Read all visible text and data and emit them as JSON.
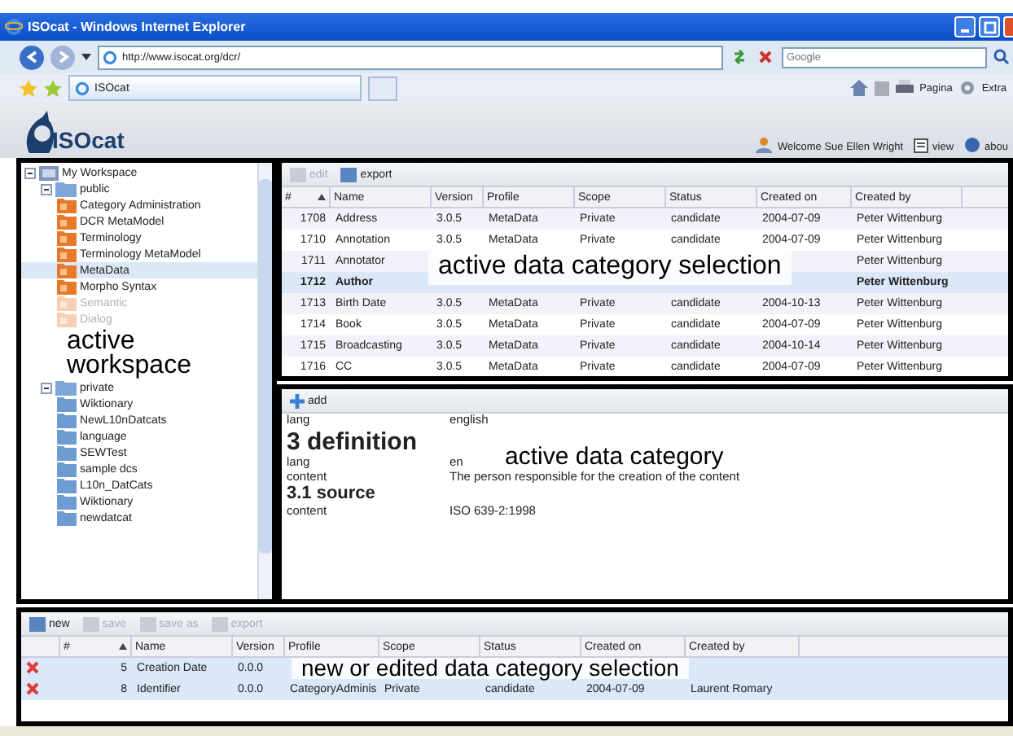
{
  "browser": {
    "title": "ISOcat - Windows Internet Explorer",
    "address": "http://www.isocat.org/dcr/",
    "search": {
      "placeholder": "Google"
    },
    "tab": "ISOcat",
    "tools": [
      "Pagina",
      "Extra"
    ]
  },
  "app": {
    "logo": "ISOcat",
    "user": "Welcome Sue Ellen Wright",
    "view": "view",
    "about": "abou"
  },
  "workspace": {
    "tree": [
      {
        "label": "My Workspace",
        "kind": "root",
        "expanded": true,
        "children": [
          {
            "label": "public",
            "kind": "folder",
            "expanded": true,
            "callout": "active workspace",
            "children": [
              {
                "label": "Category Administration",
                "kind": "shared",
                "selected": false,
                "dimmed": false
              },
              {
                "label": "DCR MetaModel",
                "kind": "shared",
                "selected": false,
                "dimmed": false
              },
              {
                "label": "Terminology",
                "kind": "shared",
                "selected": false,
                "dimmed": false
              },
              {
                "label": "Terminology MetaModel",
                "kind": "shared",
                "selected": false,
                "dimmed": false
              },
              {
                "label": "MetaData",
                "kind": "shared",
                "selected": true,
                "dimmed": false
              },
              {
                "label": "Morpho Syntax",
                "kind": "shared",
                "selected": false,
                "dimmed": false
              },
              {
                "label": "Semantic",
                "kind": "shared",
                "selected": false,
                "dimmed": true
              },
              {
                "label": "Dialog",
                "kind": "shared",
                "selected": false,
                "dimmed": true
              }
            ]
          },
          {
            "label": "private",
            "kind": "folder",
            "expanded": true,
            "children": [
              {
                "label": "Wiktionary",
                "kind": "own",
                "selected": false,
                "dimmed": false
              },
              {
                "label": "NewL10nDatcats",
                "kind": "own",
                "selected": false,
                "dimmed": false
              },
              {
                "label": "language",
                "kind": "own",
                "selected": false,
                "dimmed": false
              },
              {
                "label": "SEWTest",
                "kind": "own",
                "selected": false,
                "dimmed": false
              },
              {
                "label": "sample dcs",
                "kind": "own",
                "selected": false,
                "dimmed": false
              },
              {
                "label": "L10n_DatCats",
                "kind": "own",
                "selected": false,
                "dimmed": false
              },
              {
                "label": "Wiktionary",
                "kind": "own",
                "selected": false,
                "dimmed": false
              },
              {
                "label": "newdatcat",
                "kind": "own",
                "selected": false,
                "dimmed": false
              }
            ]
          }
        ]
      }
    ]
  },
  "selection": {
    "toolbar": [
      {
        "label": "edit",
        "disabled": true
      },
      {
        "label": "export",
        "disabled": false
      }
    ],
    "callout": "active data category selection",
    "columns": [
      "#",
      "Name",
      "Version",
      "Profile",
      "Scope",
      "Status",
      "Created on",
      "Created by"
    ],
    "rows": [
      {
        "selected": false,
        "cells": [
          "1708",
          "Address",
          "3.0.5",
          "MetaData",
          "Private",
          "candidate",
          "2004-07-09",
          "Peter Wittenburg"
        ]
      },
      {
        "selected": false,
        "cells": [
          "1710",
          "Annotation",
          "3.0.5",
          "MetaData",
          "Private",
          "candidate",
          "2004-07-09",
          "Peter Wittenburg"
        ]
      },
      {
        "selected": false,
        "cells": [
          "1711",
          "Annotator",
          null,
          null,
          null,
          null,
          null,
          "Peter Wittenburg"
        ]
      },
      {
        "selected": true,
        "cells": [
          "1712",
          "Author",
          null,
          null,
          null,
          null,
          null,
          "Peter Wittenburg"
        ]
      },
      {
        "selected": false,
        "cells": [
          "1713",
          "Birth Date",
          "3.0.5",
          "MetaData",
          "Private",
          "candidate",
          "2004-10-13",
          "Peter Wittenburg"
        ]
      },
      {
        "selected": false,
        "cells": [
          "1714",
          "Book",
          "3.0.5",
          "MetaData",
          "Private",
          "candidate",
          "2004-07-09",
          "Peter Wittenburg"
        ]
      },
      {
        "selected": false,
        "cells": [
          "1715",
          "Broadcasting",
          "3.0.5",
          "MetaData",
          "Private",
          "candidate",
          "2004-10-14",
          "Peter Wittenburg"
        ]
      },
      {
        "selected": false,
        "cells": [
          "1716",
          "CC",
          "3.0.5",
          "MetaData",
          "Private",
          "candidate",
          "2004-07-09",
          "Peter Wittenburg"
        ]
      }
    ]
  },
  "detail": {
    "toolbar": "add",
    "callout": "active data category",
    "entries": [
      {
        "kind": "field",
        "label": "lang",
        "value": "english"
      },
      {
        "kind": "heading",
        "text": "3 definition"
      },
      {
        "kind": "field",
        "label": "lang",
        "value": "en"
      },
      {
        "kind": "field",
        "label": "content",
        "value": "The person responsible for the creation of the content"
      },
      {
        "kind": "subheading",
        "text": "3.1 source"
      },
      {
        "kind": "field",
        "label": "content",
        "value": "ISO 639-2:1998"
      }
    ]
  },
  "edited": {
    "toolbar": [
      {
        "label": "new",
        "disabled": false
      },
      {
        "label": "save",
        "disabled": true
      },
      {
        "label": "save as",
        "disabled": true
      },
      {
        "label": "export",
        "disabled": true
      }
    ],
    "callout": "new or edited data category selection",
    "columns": [
      "#",
      "Name",
      "Version",
      "Profile",
      "Scope",
      "Status",
      "Created on",
      "Created by"
    ],
    "rows": [
      {
        "cells": [
          "5",
          "Creation Date",
          "0.0.0",
          null,
          null,
          null,
          null,
          null
        ]
      },
      {
        "cells": [
          "8",
          "Identifier",
          "0.0.0",
          "CategoryAdminis",
          "Private",
          "candidate",
          "2004-07-09",
          "Laurent Romary"
        ]
      }
    ]
  }
}
